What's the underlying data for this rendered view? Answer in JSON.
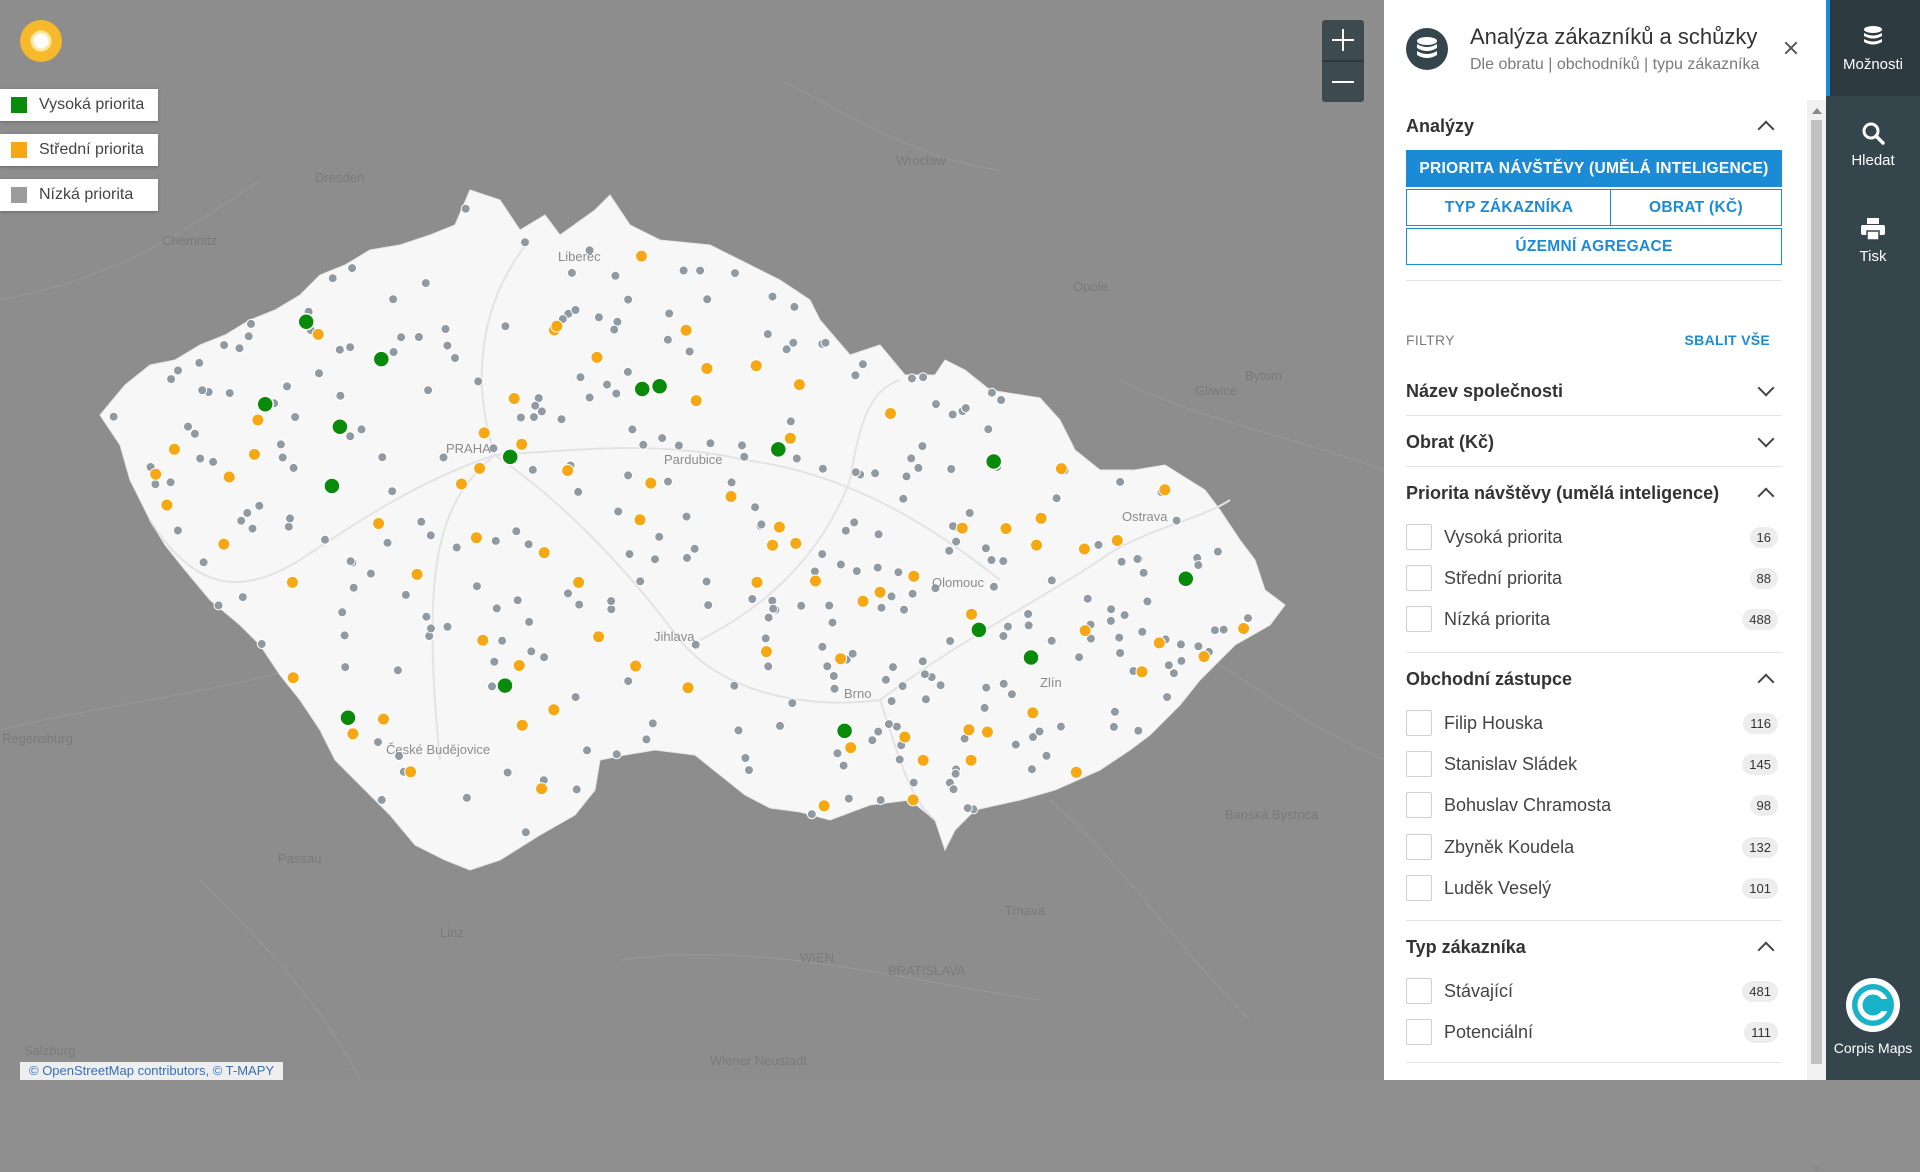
{
  "legend": [
    {
      "label": "Vysoká priorita",
      "color": "#0a8a0a"
    },
    {
      "label": "Střední priorita",
      "color": "#f5a814"
    },
    {
      "label": "Nízká priorita",
      "color": "#9c9c9c"
    }
  ],
  "map": {
    "attribution": "© OpenStreetMap contributors, © T-MAPY",
    "labels": {
      "dresden": "Dresden",
      "wroclaw": "Wrocław",
      "chemnitz": "Chemnitz",
      "liberec": "Liberec",
      "opole": "Opole",
      "bytom": "Bytom",
      "gliwice": "Gliwice",
      "praha": "PRAHA",
      "pardubice": "Pardubice",
      "ostrava": "Ostrava",
      "olomouc": "Olomouc",
      "jihlava": "Jihlava",
      "zlin": "Zlín",
      "brno": "Brno",
      "ceske_budejovice": "České Budějovice",
      "regensburg": "Regensburg",
      "passau": "Passau",
      "linz": "Linz",
      "wien": "WIEN",
      "bratislava": "BRATISLAVA",
      "trnava": "Trnava",
      "banska_bystrica": "Banská Bystrica",
      "wiener_neustadt": "Wiener Neustadt",
      "salzburg": "Salzburg"
    }
  },
  "panel": {
    "title": "Analýza zákazníků a schůzky",
    "subtitle": "Dle obratu | obchodníků | typu zákazníka",
    "analyses": {
      "heading": "Analýzy",
      "buttons": {
        "priority": "PRIORITA NÁVŠTĚVY (UMĚLÁ INTELIGENCE)",
        "customer_type": "TYP ZÁKAZNÍKA",
        "turnover": "OBRAT (KČ)",
        "territorial": "ÚZEMNÍ AGREGACE"
      }
    },
    "filters_label": "FILTRY",
    "collapse_all": "SBALIT VŠE",
    "sections": {
      "company_name": "Název společnosti",
      "turnover": "Obrat (Kč)",
      "priority": {
        "title": "Priorita návštěvy (umělá inteligence)",
        "options": [
          {
            "label": "Vysoká priorita",
            "count": "16"
          },
          {
            "label": "Střední priorita",
            "count": "88"
          },
          {
            "label": "Nízká priorita",
            "count": "488"
          }
        ]
      },
      "sales_rep": {
        "title": "Obchodní zástupce",
        "options": [
          {
            "label": "Filip Houska",
            "count": "116"
          },
          {
            "label": "Stanislav Sládek",
            "count": "145"
          },
          {
            "label": "Bohuslav Chramosta",
            "count": "98"
          },
          {
            "label": "Zbyněk Koudela",
            "count": "132"
          },
          {
            "label": "Luděk Veselý",
            "count": "101"
          }
        ]
      },
      "customer_type": {
        "title": "Typ zákazníka",
        "options": [
          {
            "label": "Stávající",
            "count": "481"
          },
          {
            "label": "Potenciální",
            "count": "111"
          }
        ]
      }
    }
  },
  "nav": {
    "options": "Možnosti",
    "search": "Hledat",
    "print": "Tisk",
    "brand": "Corpis Maps"
  }
}
